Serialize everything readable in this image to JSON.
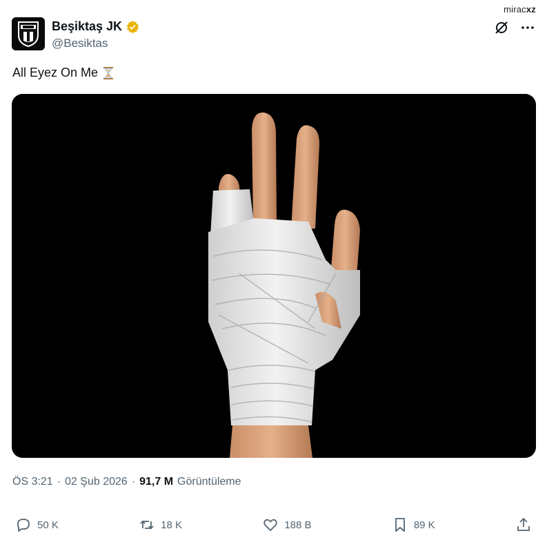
{
  "watermark": {
    "prefix": "mirac",
    "suffix": "xz"
  },
  "author": {
    "display_name": "Beşiktaş JK",
    "handle": "@Besiktas",
    "verified_color": "#e8b400"
  },
  "tweet": {
    "text": "All Eyez On Me",
    "emoji": "hourglass-icon"
  },
  "meta": {
    "time": "ÖS 3:21",
    "separator1": "·",
    "date": "02 Şub 2026",
    "separator2": "·",
    "views_count": "91,7 M",
    "views_label": "Görüntüleme"
  },
  "actions": {
    "replies": "50 K",
    "reposts": "18 K",
    "likes": "188 B",
    "bookmarks": "89 K"
  },
  "colors": {
    "text_primary": "#0f1419",
    "text_secondary": "#536471",
    "media_bg": "#000000"
  }
}
